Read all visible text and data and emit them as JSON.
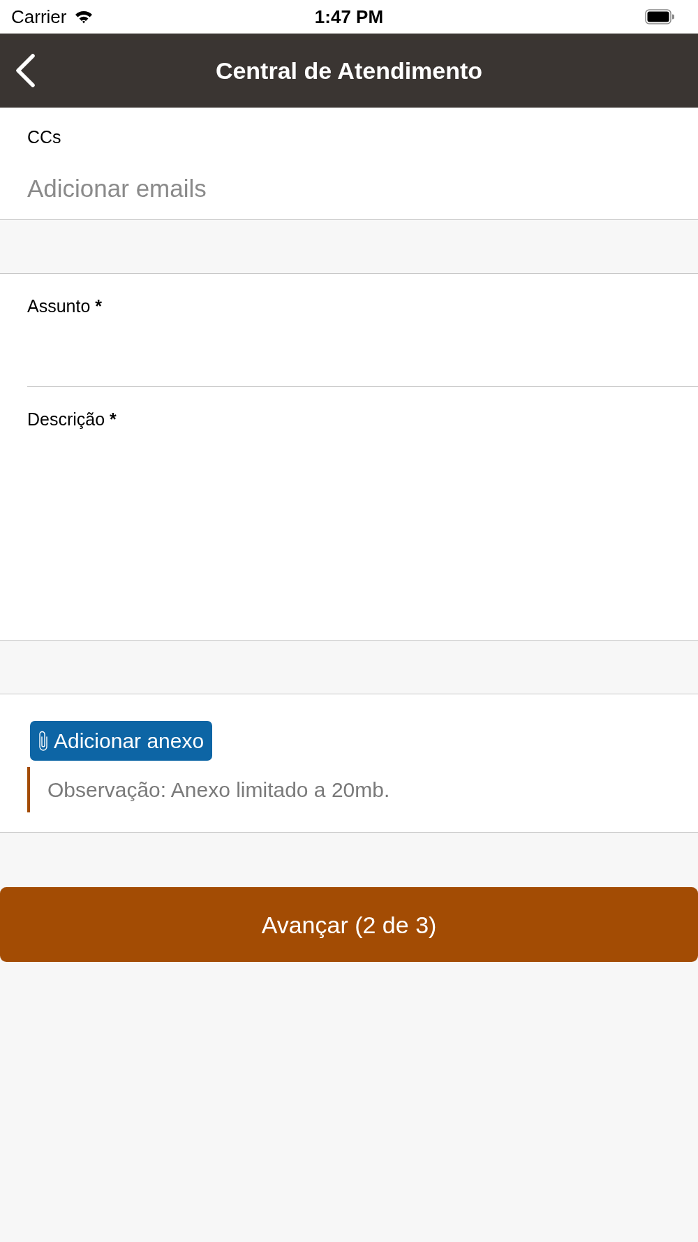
{
  "status_bar": {
    "carrier": "Carrier",
    "time": "1:47 PM"
  },
  "nav_bar": {
    "title": "Central de Atendimento"
  },
  "cc_field": {
    "label": "CCs",
    "placeholder": "Adicionar emails"
  },
  "fields": [
    {
      "kind": "single_line",
      "label": "Assunto",
      "required": true,
      "required_mark": "*"
    },
    {
      "kind": "multi_line",
      "label": "Descrição",
      "required": true,
      "required_mark": "*"
    }
  ],
  "attachment": {
    "button": "Adicionar anexo",
    "note": "Observação: Anexo limitado a 20mb."
  },
  "submit_button": "Avançar (2 de 3)"
}
